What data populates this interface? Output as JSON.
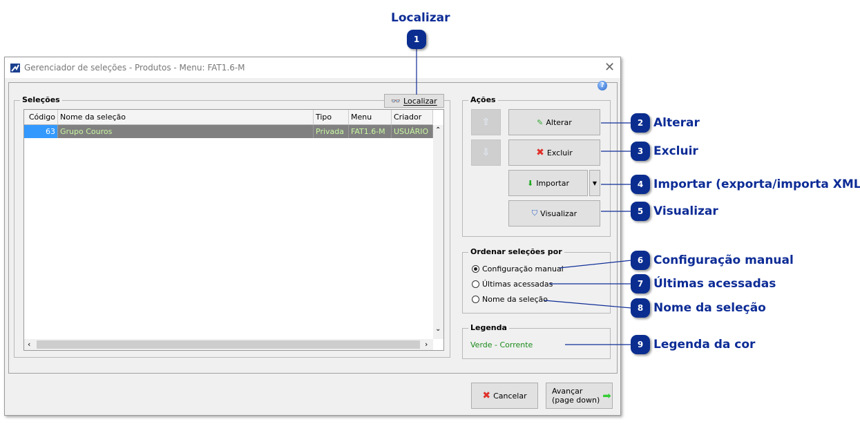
{
  "window": {
    "title": "Gerenciador de seleções - Produtos - Menu: FAT1.6-M"
  },
  "selecoes": {
    "label": "Seleções",
    "localizar": "Localizar",
    "columns": [
      "Código",
      "Nome da seleção",
      "Tipo",
      "Menu",
      "Criador"
    ],
    "rows": [
      {
        "codigo": "63",
        "nome": "Grupo Couros",
        "tipo": "Privada",
        "menu": "FAT1.6-M",
        "criador": "USUÁRIO"
      }
    ]
  },
  "acoes": {
    "label": "Ações",
    "alterar": "Alterar",
    "excluir": "Excluir",
    "importar": "Importar",
    "visualizar": "Visualizar"
  },
  "ordenar": {
    "label": "Ordenar seleções por",
    "options": [
      "Configuração manual",
      "Últimas acessadas",
      "Nome da seleção"
    ],
    "selected": "Configuração manual"
  },
  "legenda": {
    "label": "Legenda",
    "text": "Verde - Corrente",
    "color": "#1a8a1a"
  },
  "footer": {
    "cancelar": "Cancelar",
    "avancar_1": "Avançar",
    "avancar_2": "(page down)"
  },
  "callouts": [
    {
      "n": "1",
      "label": "Localizar"
    },
    {
      "n": "2",
      "label": "Alterar"
    },
    {
      "n": "3",
      "label": "Excluir"
    },
    {
      "n": "4",
      "label": "Importar (exporta/importa XML)"
    },
    {
      "n": "5",
      "label": "Visualizar"
    },
    {
      "n": "6",
      "label": "Configuração manual"
    },
    {
      "n": "7",
      "label": "Últimas acessadas"
    },
    {
      "n": "8",
      "label": "Nome da seleção"
    },
    {
      "n": "9",
      "label": "Legenda da cor"
    }
  ],
  "colors": {
    "callout": "#0a2d8f",
    "selected_row": "#808080",
    "row_text": "#c8f7a0",
    "code_cell": "#3399ff"
  }
}
